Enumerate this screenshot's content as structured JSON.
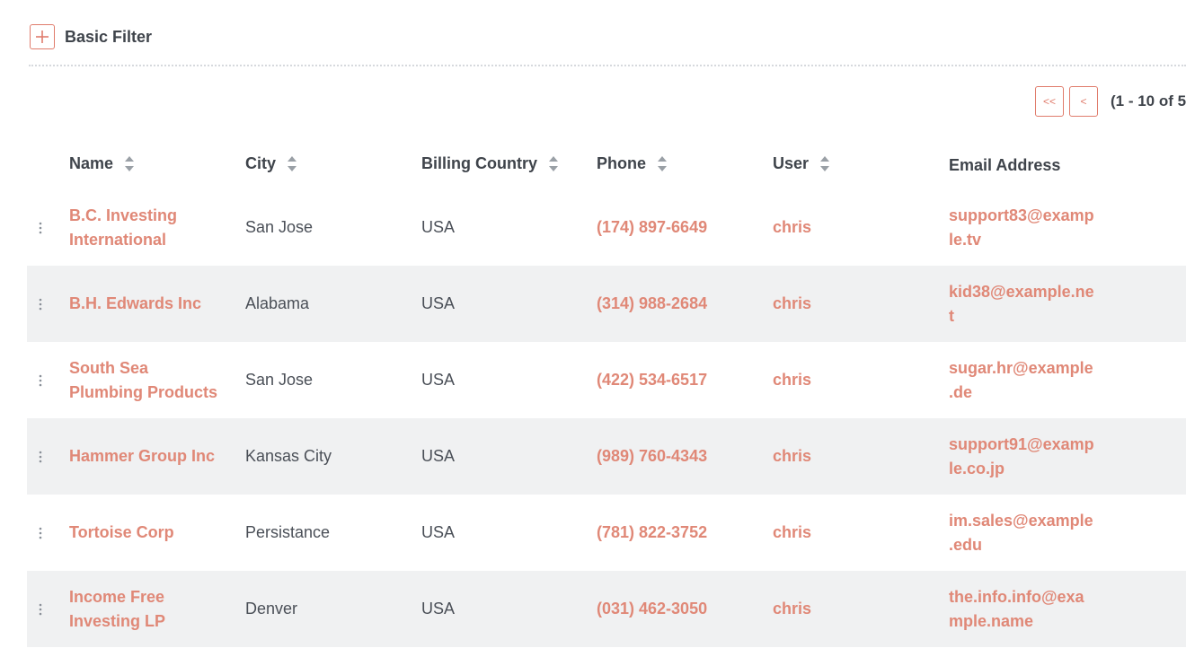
{
  "filter": {
    "label": "Basic Filter"
  },
  "pagination": {
    "first_label": "<<",
    "prev_label": "<",
    "info": "(1 - 10 of 5"
  },
  "table": {
    "columns": [
      {
        "label": "Name",
        "sortable": true
      },
      {
        "label": "City",
        "sortable": true
      },
      {
        "label": "Billing Country",
        "sortable": true
      },
      {
        "label": "Phone",
        "sortable": true
      },
      {
        "label": "User",
        "sortable": true
      },
      {
        "label": "Email Address",
        "sortable": false
      }
    ],
    "rows": [
      {
        "name_1": "B.C. Investing",
        "name_2": "International",
        "city": "San Jose",
        "country": "USA",
        "phone": "(174) 897-6649",
        "user": "chris",
        "email_1": "support83@examp",
        "email_2": "le.tv"
      },
      {
        "name_1": "B.H. Edwards Inc",
        "name_2": "",
        "city": "Alabama",
        "country": "USA",
        "phone": "(314) 988-2684",
        "user": "chris",
        "email_1": "kid38@example.ne",
        "email_2": "t"
      },
      {
        "name_1": "South Sea",
        "name_2": "Plumbing Products",
        "city": "San Jose",
        "country": "USA",
        "phone": "(422) 534-6517",
        "user": "chris",
        "email_1": "sugar.hr@example",
        "email_2": ".de"
      },
      {
        "name_1": "Hammer Group Inc",
        "name_2": "",
        "city": "Kansas City",
        "country": "USA",
        "phone": "(989) 760-4343",
        "user": "chris",
        "email_1": "support91@examp",
        "email_2": "le.co.jp"
      },
      {
        "name_1": "Tortoise Corp",
        "name_2": "",
        "city": "Persistance",
        "country": "USA",
        "phone": "(781) 822-3752",
        "user": "chris",
        "email_1": "im.sales@example",
        "email_2": ".edu"
      },
      {
        "name_1": "Income Free",
        "name_2": "Investing LP",
        "city": "Denver",
        "country": "USA",
        "phone": "(031) 462-3050",
        "user": "chris",
        "email_1": "the.info.info@exa",
        "email_2": "mple.name"
      }
    ]
  },
  "colors": {
    "accent": "#e07c6c",
    "link": "#e08877",
    "alt_row": "#f0f1f2",
    "divider": "#d6d9dd"
  },
  "icons": {
    "add": "plus-icon",
    "sort": "sort-arrows-icon",
    "drag": "vertical-dots-icon"
  }
}
